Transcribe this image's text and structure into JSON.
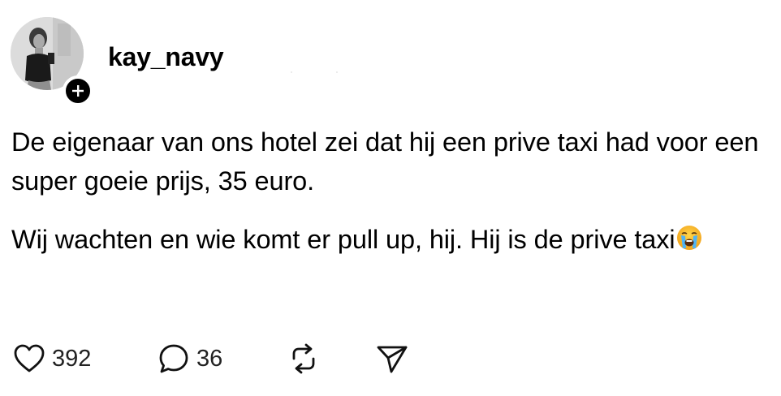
{
  "post": {
    "username": "kay_navy",
    "paragraphs": [
      "De eigenaar van ons hotel zei dat hij een prive taxi had voor een super goeie prijs, 35 euro.",
      "Wij wachten en wie komt er pull up, hij. Hij is de prive taxi"
    ],
    "emoji": "loudly-crying-face"
  },
  "actions": {
    "likes": "392",
    "replies": "36"
  },
  "icons": {
    "like": "heart-icon",
    "reply": "comment-icon",
    "repost": "repost-icon",
    "share": "send-icon",
    "follow": "plus-icon"
  },
  "colors": {
    "text": "#000000",
    "count": "#222222",
    "badge": "#000000"
  }
}
